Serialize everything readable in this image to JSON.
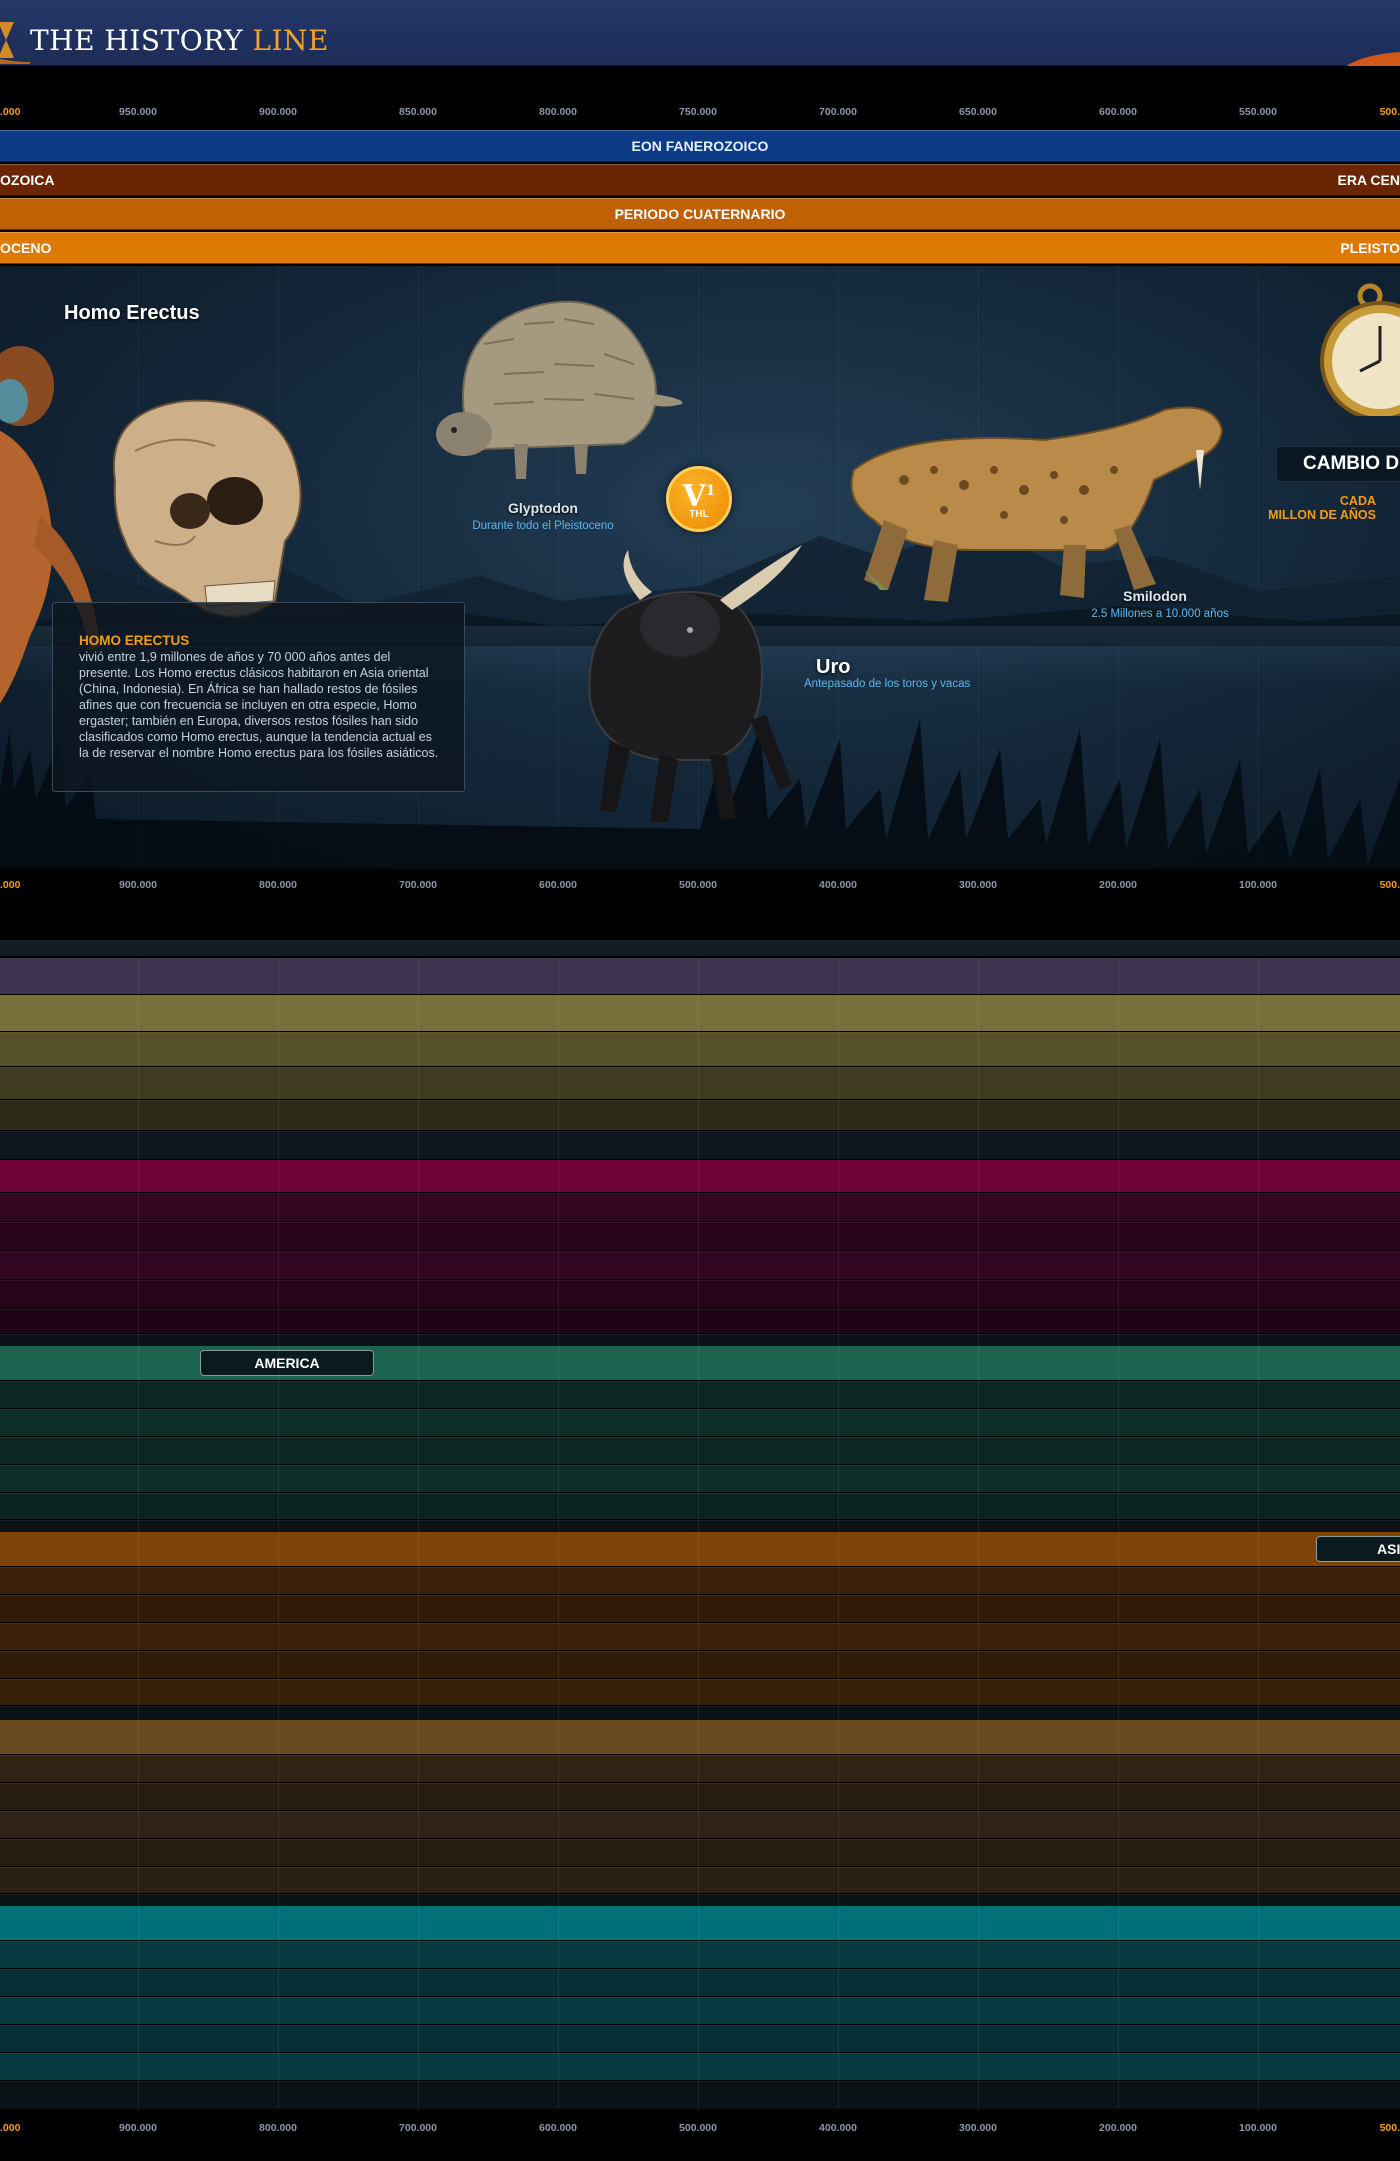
{
  "header": {
    "logo_main": "THE HISTORY ",
    "logo_accent": "LINE"
  },
  "ruler_top": {
    "ticks": [
      "950.000",
      "900.000",
      "850.000",
      "800.000",
      "750.000",
      "700.000",
      "650.000",
      "600.000",
      "550.000"
    ],
    "edge_left": ".000",
    "edge_right": "500."
  },
  "ruler_bottom": {
    "ticks": [
      "900.000",
      "800.000",
      "700.000",
      "600.000",
      "500.000",
      "400.000",
      "300.000",
      "200.000",
      "100.000"
    ],
    "edge_left": ".000",
    "edge_right": "500."
  },
  "bands": {
    "eon": "EON FANEROZOICO",
    "era_left": "OZOICA",
    "era_right": "ERA CEN",
    "period": "PERIODO CUATERNARIO",
    "epoch_left": "OCENO",
    "epoch_right": "PLEISTO"
  },
  "scene": {
    "title": "Homo Erectus",
    "glyptodon_name": "Glyptodon",
    "glyptodon_sub": "Durante todo el Pleistoceno",
    "uro_name": "Uro",
    "uro_sub": "Antepasado de los toros y vacas",
    "smilodon_name": "Smilodon",
    "smilodon_sub": "2.5 Millones a 10.000 años",
    "info_title": "HOMO ERECTUS",
    "info_text": "vivió entre 1,9 millones de años y 70 000 años antes del presente. Los Homo erectus clásicos habitaron en Asia oriental (China, Indonesia). En África se han hallado restos de fósiles afines que con frecuencia se incluyen en otra especie, Homo ergaster; también en Europa, diversos restos fósiles han sido clasificados como Homo erectus, aunque la tendencia actual es la de reservar el nombre Homo erectus para los fósiles asiáticos.",
    "badge_letter": "V",
    "badge_sup": "1",
    "badge_sub": "THL",
    "change_title": "CAMBIO D",
    "change_sub_1": "CADA",
    "change_sub_2": "MILLON DE AÑOS"
  },
  "regions": {
    "america_label": "AMERICA",
    "asia_label": "ASI"
  },
  "colors": {
    "accent_orange": "#f39b1b",
    "eon_blue": "#0d3b86",
    "era_brown": "#6a2602",
    "period_orange": "#bf6004",
    "epoch_orange": "#dc7a05",
    "subtitle_blue": "#5fb6ee"
  }
}
